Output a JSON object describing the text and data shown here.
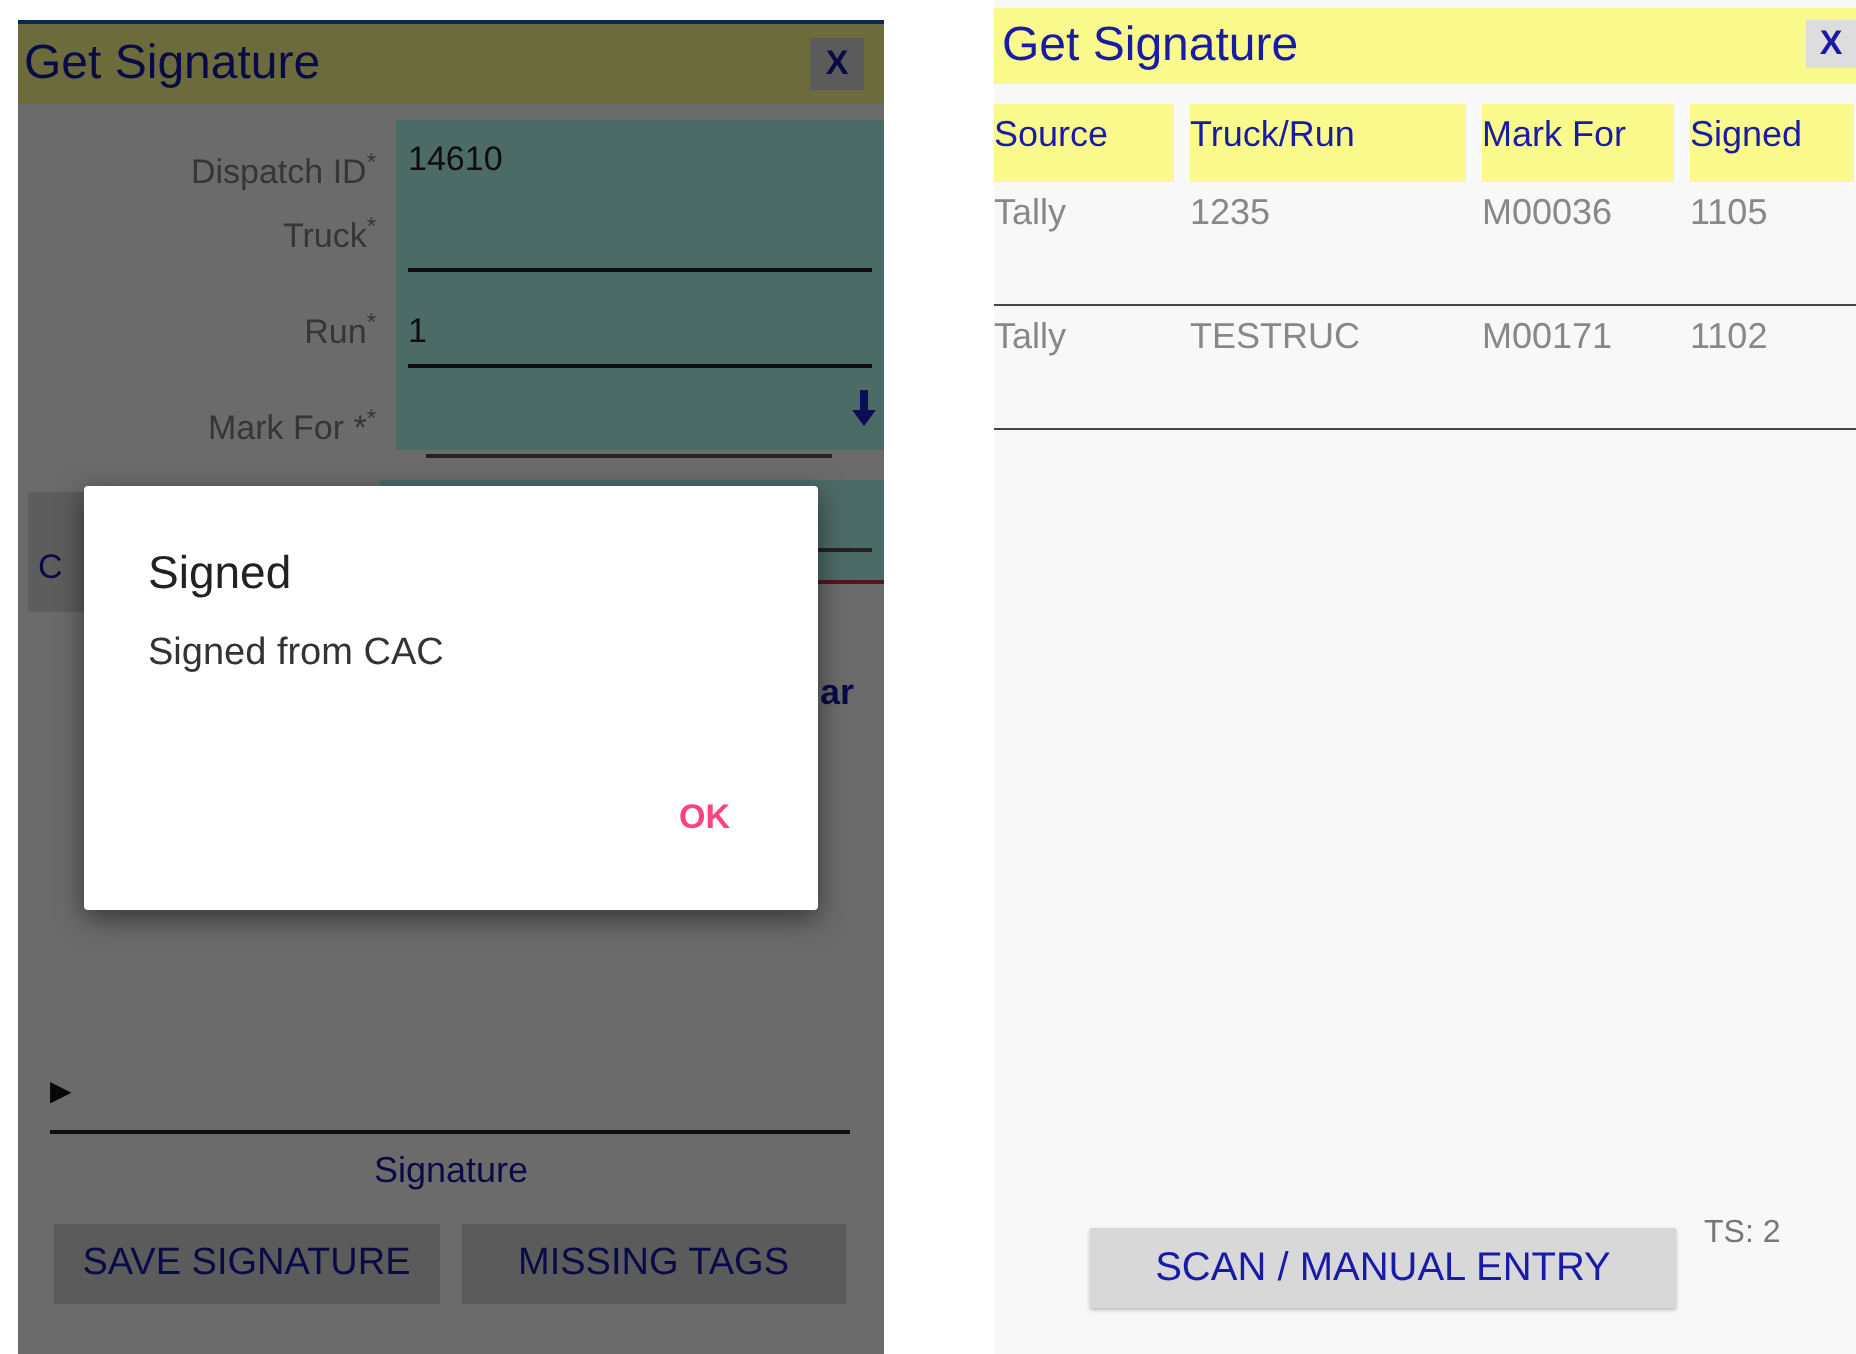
{
  "form_screen": {
    "title": "Get Signature",
    "close_label": "X",
    "fields": [
      {
        "kind": "text",
        "label": "Dispatch ID",
        "required_mark": "*",
        "value": "14610"
      },
      {
        "kind": "text",
        "label": "Truck",
        "required_mark": "*"
      },
      {
        "kind": "text",
        "label": "Run",
        "required_mark": "*",
        "value": "1"
      },
      {
        "kind": "dropdown",
        "label": "Mark For *",
        "required_mark": "*"
      }
    ],
    "left_fragment": "C",
    "right_fragment": "ar",
    "signature": {
      "marker": "▶",
      "label": "Signature"
    },
    "buttons": [
      "SAVE SIGNATURE",
      "MISSING TAGS"
    ],
    "dialog": {
      "title": "Signed",
      "message": "Signed from CAC",
      "button": "OK"
    }
  },
  "list_screen": {
    "title": "Get Signature",
    "close_label": "X",
    "columns": [
      "Source",
      "Truck/Run",
      "Mark For",
      "Signed"
    ],
    "rows": [
      [
        "Tally",
        "1235",
        "M00036",
        "1105"
      ],
      [
        "Tally",
        "TESTRUC",
        "M00171",
        "1102"
      ]
    ],
    "button": "SCAN / MANUAL ENTRY",
    "counter": "TS: 2"
  }
}
